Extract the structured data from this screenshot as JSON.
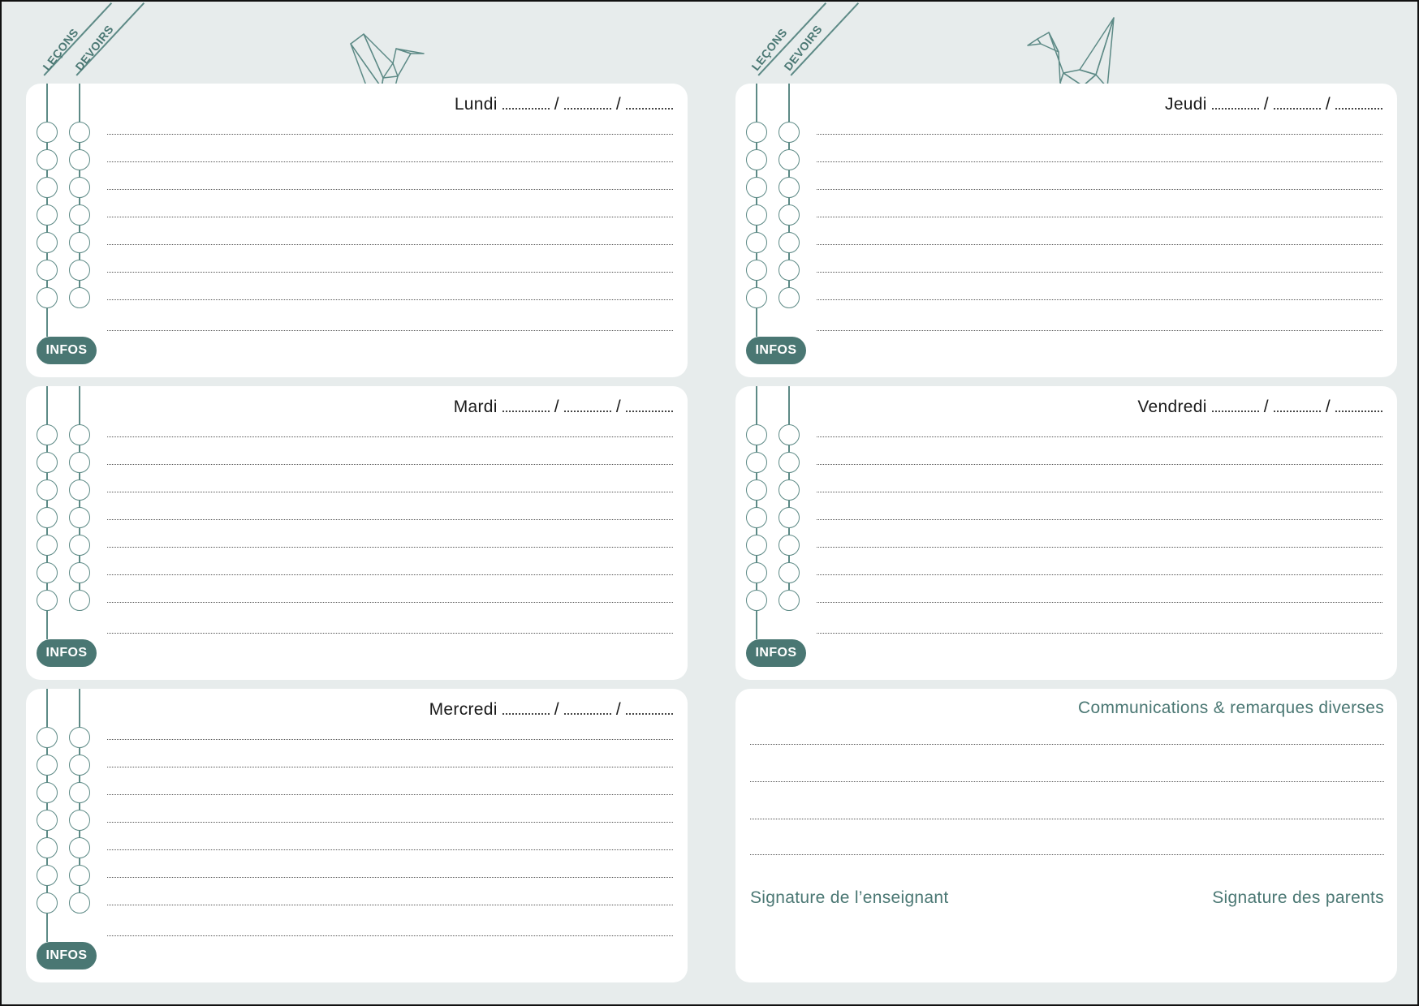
{
  "left_page": {
    "tabs": {
      "lessons": "LEÇONS",
      "homework": "DEVOIRS"
    },
    "days": [
      {
        "name": "Lundi",
        "infos_label": "INFOS"
      },
      {
        "name": "Mardi",
        "infos_label": "INFOS"
      },
      {
        "name": "Mercredi",
        "infos_label": "INFOS"
      }
    ]
  },
  "right_page": {
    "tabs": {
      "lessons": "LEÇONS",
      "homework": "DEVOIRS"
    },
    "days": [
      {
        "name": "Jeudi",
        "infos_label": "INFOS"
      },
      {
        "name": "Vendredi",
        "infos_label": "INFOS"
      }
    ],
    "communications": {
      "title": "Communications & remarques diverses",
      "teacher_signature": "Signature de l’enseignant",
      "parent_signature": "Signature des parents"
    }
  },
  "date_separator": "/",
  "icons": [
    "origami-crane-icon"
  ],
  "colors": {
    "page_background": "#e7ecec",
    "card_background": "#ffffff",
    "accent": "#4a7773",
    "line": "#5d8a86"
  }
}
